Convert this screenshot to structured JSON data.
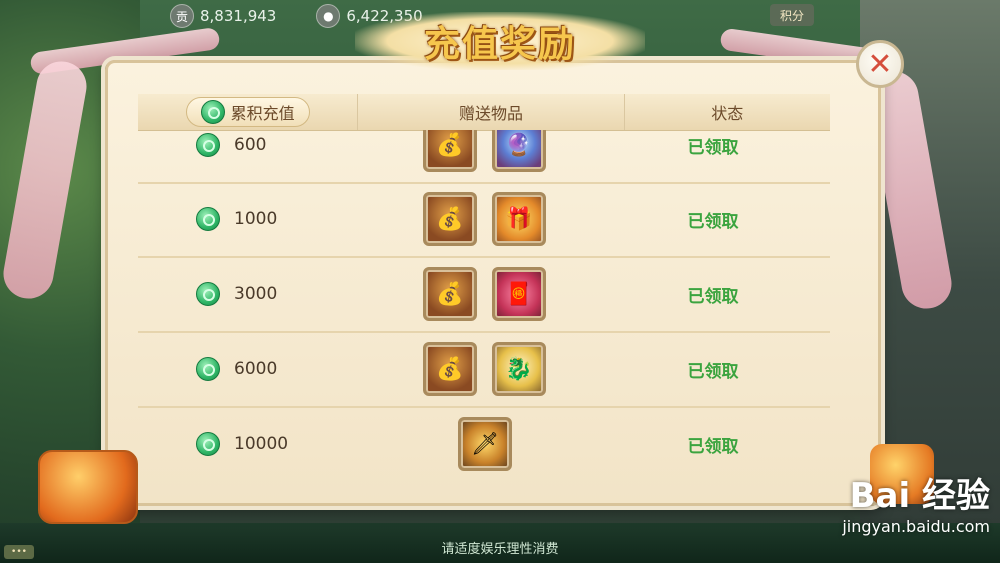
{
  "topbar": {
    "contribution_icon": "贡",
    "contribution_value": "8,831,943",
    "gold_value": "6,422,350",
    "points_label": "积分"
  },
  "dialog": {
    "title": "充值奖励",
    "close_icon": "close-x-icon",
    "columns": [
      "累积充值",
      "赠送物品",
      "状态"
    ]
  },
  "rows": [
    {
      "amount": "600",
      "gifts": [
        "silver-treasure-bag-icon",
        "crystal-orb-icon"
      ],
      "status": "已领取"
    },
    {
      "amount": "1000",
      "gifts": [
        "silver-treasure-bag-icon",
        "lucky-bag-icon"
      ],
      "status": "已领取"
    },
    {
      "amount": "3000",
      "gifts": [
        "silver-treasure-bag-icon",
        "red-lucky-bag-icon"
      ],
      "status": "已领取"
    },
    {
      "amount": "6000",
      "gifts": [
        "silver-treasure-bag-icon",
        "golden-dragon-pet-icon"
      ],
      "status": "已领取"
    },
    {
      "amount": "10000",
      "gifts": [
        "golden-weapon-icon"
      ],
      "status": "已领取"
    }
  ],
  "footer": {
    "note": "请适度娱乐理性消费"
  },
  "watermark": {
    "top": "Bai 经验",
    "bottom": "jingyan.baidu.com"
  },
  "colors": {
    "status_green": "#3ba43f",
    "title_gold": "#f6c64d",
    "close_red": "#d54e3c"
  }
}
